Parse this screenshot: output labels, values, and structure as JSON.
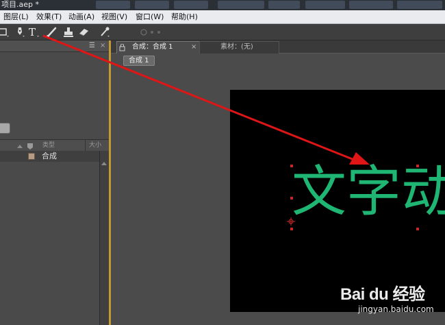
{
  "window": {
    "title": "项目.aep *"
  },
  "menu": [
    "图层(L)",
    "效果(T)",
    "动画(A)",
    "视图(V)",
    "窗口(W)",
    "帮助(H)"
  ],
  "toolbar": {
    "tools": [
      "rectangle-tool-icon",
      "pen-tool-icon",
      "type-tool-icon",
      "brush-tool-icon",
      "clone-stamp-tool-icon",
      "eraser-tool-icon",
      "puppet-pin-tool-icon"
    ],
    "menu_icon": "☰",
    "close_icon": "×"
  },
  "project_panel": {
    "columns": {
      "type": "类型",
      "size": "大小"
    },
    "items": [
      {
        "name": "合成",
        "swatch_color": "#b79c85"
      }
    ]
  },
  "composition_panel": {
    "tabs": [
      {
        "label": "合成：合成 1",
        "active": true
      },
      {
        "label": "素材：(无)",
        "active": false
      }
    ],
    "breadcrumb": "合成 1",
    "canvas_text": "文字动",
    "text_color": "#1fb573"
  },
  "annotation": {
    "arrow_color": "#e01515"
  },
  "watermark": {
    "brand": "Bai du 经验",
    "url": "jingyan.baidu.com"
  }
}
